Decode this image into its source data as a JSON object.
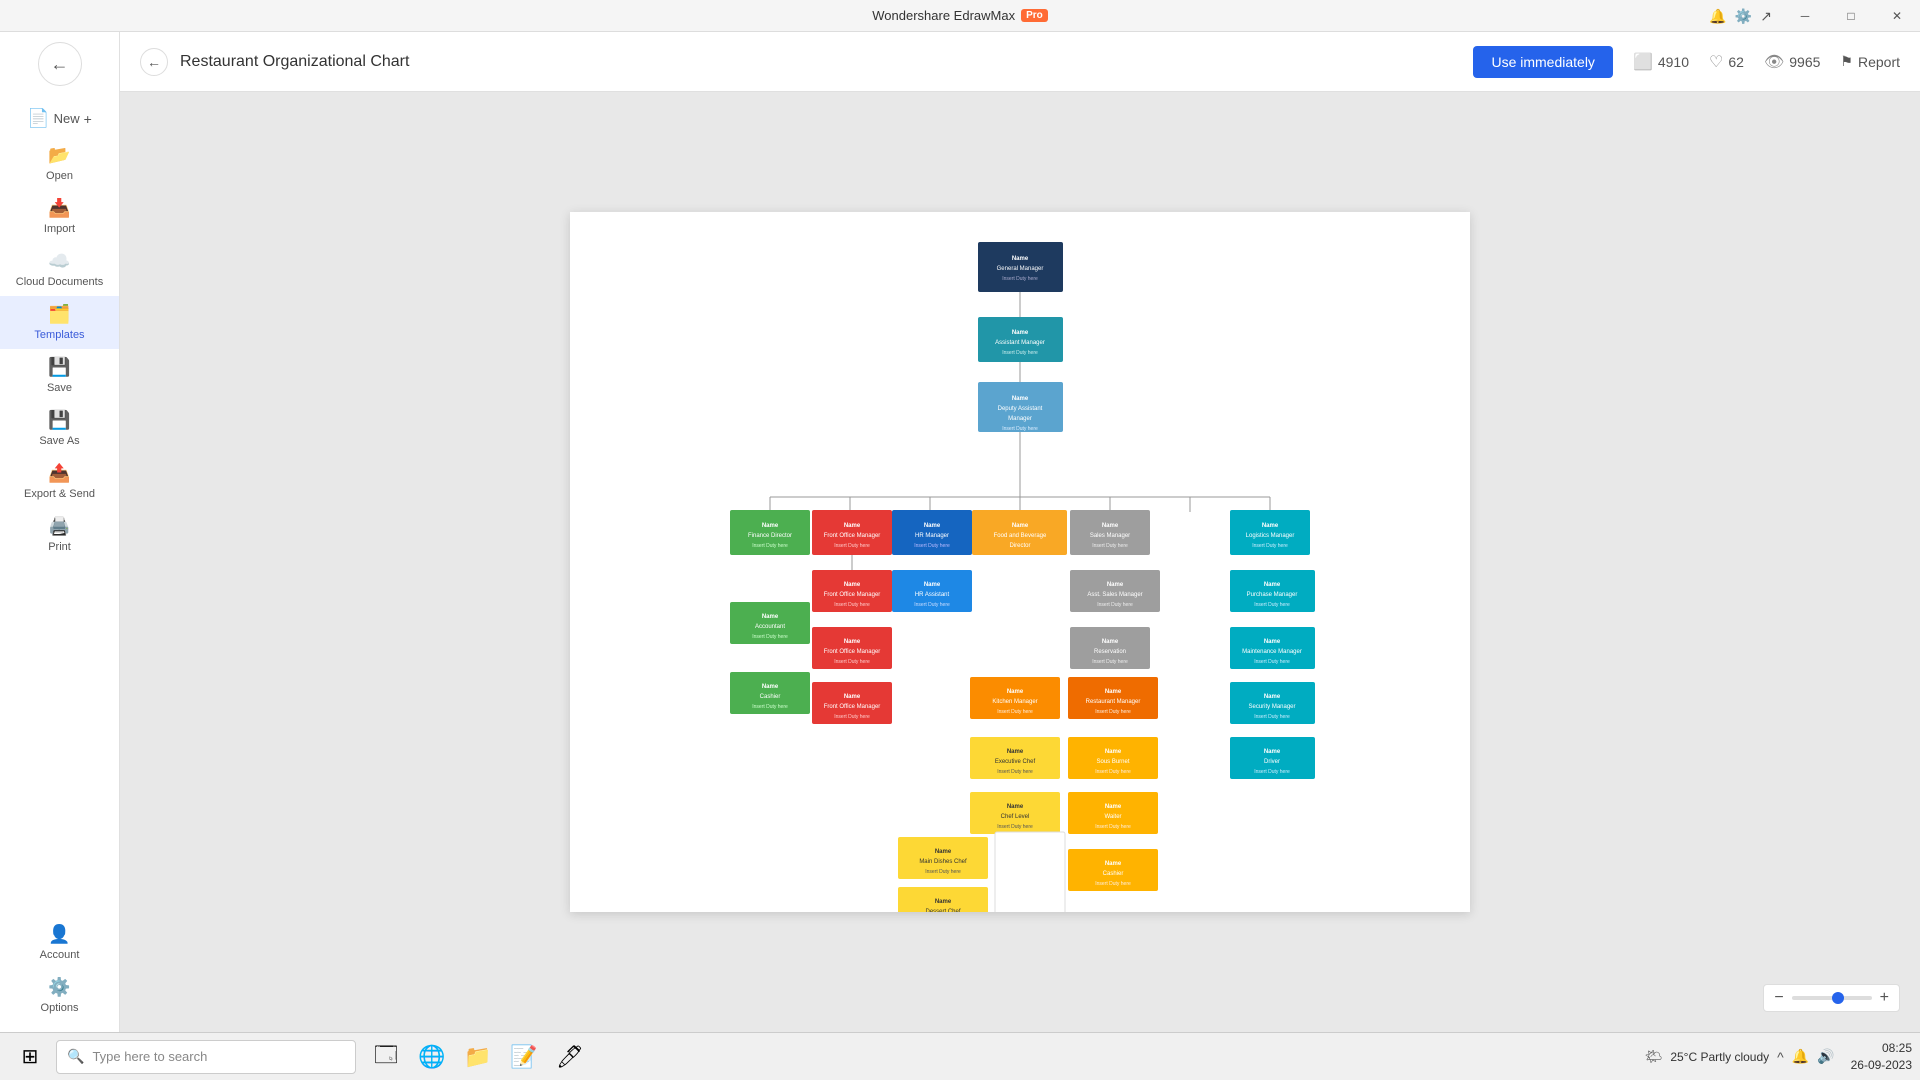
{
  "app": {
    "title": "Wondershare EdrawMax",
    "pro_badge": "Pro",
    "window_controls": [
      "minimize",
      "restore",
      "close"
    ]
  },
  "sidebar": {
    "back_tooltip": "Back",
    "items": [
      {
        "id": "new",
        "label": "New",
        "icon": "📄",
        "has_plus": true,
        "active": false
      },
      {
        "id": "open",
        "label": "Open",
        "icon": "📂",
        "active": false
      },
      {
        "id": "import",
        "label": "Import",
        "icon": "📥",
        "active": false
      },
      {
        "id": "cloud",
        "label": "Cloud Documents",
        "icon": "☁️",
        "active": false
      },
      {
        "id": "templates",
        "label": "Templates",
        "icon": "🗂️",
        "active": true
      },
      {
        "id": "save",
        "label": "Save",
        "icon": "💾",
        "active": false
      },
      {
        "id": "saveas",
        "label": "Save As",
        "icon": "💾",
        "active": false
      },
      {
        "id": "export",
        "label": "Export & Send",
        "icon": "📤",
        "active": false
      },
      {
        "id": "print",
        "label": "Print",
        "icon": "🖨️",
        "active": false
      }
    ],
    "bottom_items": [
      {
        "id": "account",
        "label": "Account",
        "icon": "👤"
      },
      {
        "id": "options",
        "label": "Options",
        "icon": "⚙️"
      }
    ]
  },
  "header": {
    "title": "Restaurant Organizational Chart",
    "use_immediately": "Use immediately",
    "stats": {
      "downloads": {
        "icon": "copy",
        "value": "4910"
      },
      "likes": {
        "icon": "heart",
        "value": "62"
      },
      "views": {
        "icon": "eye",
        "value": "9965"
      }
    },
    "report_label": "Report"
  },
  "zoom": {
    "minus": "−",
    "plus": "+",
    "level": 50
  },
  "taskbar": {
    "search_placeholder": "Type here to search",
    "apps": [
      "⊞",
      "🔍",
      "🗔",
      "🌐",
      "📁",
      "📝"
    ],
    "weather": "25°C  Partly cloudy",
    "time": "08:25",
    "date": "26-09-2023"
  }
}
